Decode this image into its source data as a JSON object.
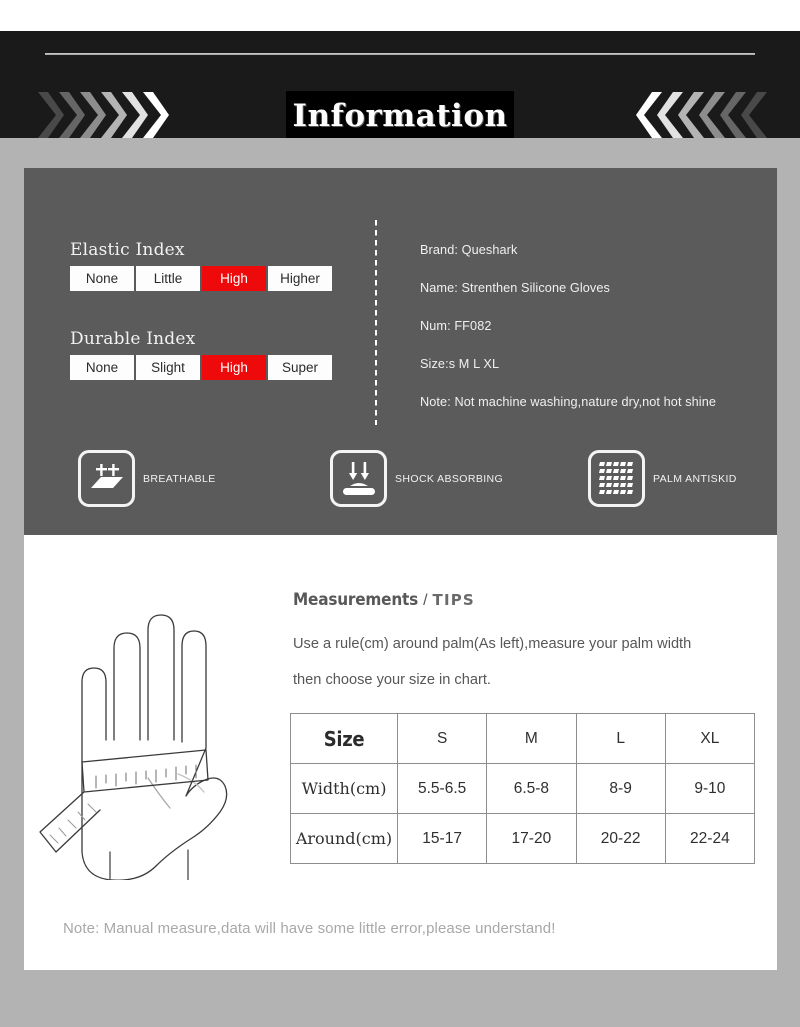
{
  "header": {
    "title": "Information",
    "chevron_count_left": 6,
    "chevron_count_right": 6,
    "bg_color": "#1a1a1a"
  },
  "theme": {
    "page_bg": "#b3b3b3",
    "dark_panel_bg": "#5b5b5b",
    "accent_red": "#ee0a0a",
    "white_panel_bg": "#ffffff"
  },
  "indices": [
    {
      "title": "Elastic Index",
      "options": [
        "None",
        "Little",
        "High",
        "Higher"
      ],
      "selected": "High"
    },
    {
      "title": "Durable Index",
      "options": [
        "None",
        "Slight",
        "High",
        "Super"
      ],
      "selected": "High"
    }
  ],
  "specs": [
    "Brand: Queshark",
    "Name: Strenthen Silicone Gloves",
    "Num: FF082",
    "Size:s M L XL",
    "Note: Not machine washing,nature dry,not hot shine"
  ],
  "features": [
    {
      "label": "BREATHABLE",
      "icon": "breathable-icon"
    },
    {
      "label": "SHOCK ABSORBING",
      "icon": "shock-absorbing-icon"
    },
    {
      "label": "PALM ANTISKID",
      "icon": "palm-antiskid-icon"
    }
  ],
  "measurements": {
    "heading_strong": "Measurements",
    "heading_slash": "/",
    "heading_tips": "TIPS",
    "body": "Use a rule(cm) around palm(As left),measure your palm width then choose your size in chart.",
    "illustration": "hand-with-measuring-tape"
  },
  "chart_data": {
    "type": "table",
    "title": "Size",
    "categories": [
      "S",
      "M",
      "L",
      "XL"
    ],
    "rows": [
      {
        "name": "Width(cm)",
        "values": [
          "5.5-6.5",
          "6.5-8",
          "8-9",
          "9-10"
        ]
      },
      {
        "name": "Around(cm)",
        "values": [
          "15-17",
          "17-20",
          "20-22",
          "22-24"
        ]
      }
    ]
  },
  "footer": {
    "note": "Note: Manual measure,data will have some little error,please understand!"
  }
}
